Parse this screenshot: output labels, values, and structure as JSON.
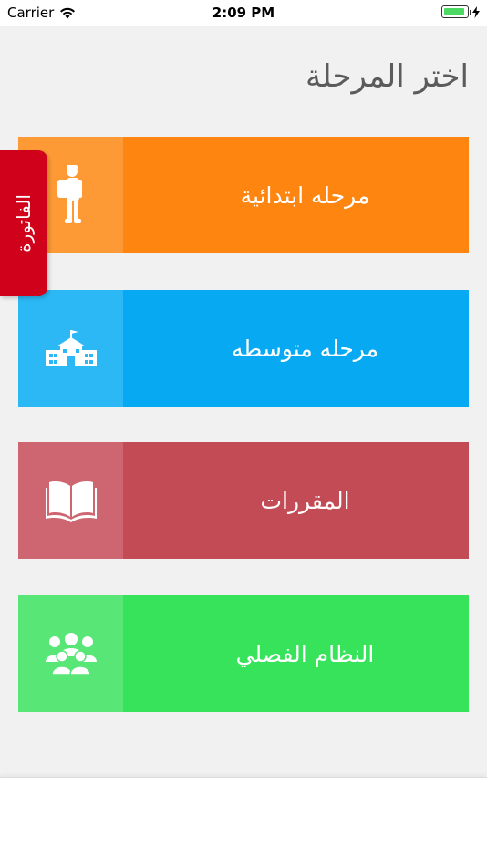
{
  "status_bar": {
    "carrier": "Carrier",
    "time": "2:09 PM",
    "wifi_icon": "wifi-icon",
    "battery_icon": "battery-icon",
    "charging_icon": "bolt-icon"
  },
  "header": {
    "title": "اختر المرحلة"
  },
  "side_tab": {
    "label": "الفاتورة",
    "color": "#d0021b"
  },
  "menu": [
    {
      "label": "مرحله ابتدائية",
      "icon": "student-icon",
      "color": "#fe8510",
      "icon_bg": "#fd9a35"
    },
    {
      "label": "مرحله متوسطه",
      "icon": "school-icon",
      "color": "#06a9f2",
      "icon_bg": "#2cb8f5"
    },
    {
      "label": "المقررات",
      "icon": "book-icon",
      "color": "#c34b55",
      "icon_bg": "#cd6670"
    },
    {
      "label": "النظام الفصلي",
      "icon": "group-icon",
      "color": "#38e35c",
      "icon_bg": "#58e677"
    }
  ]
}
